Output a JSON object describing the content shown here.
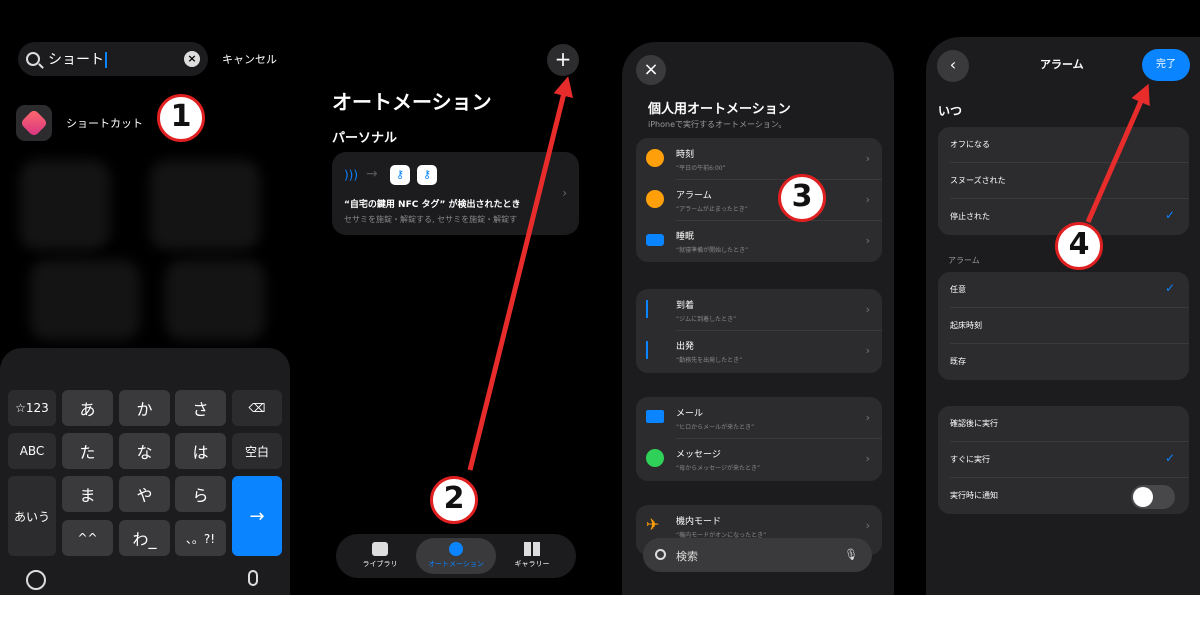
{
  "panel1": {
    "search_value": "ショート",
    "cancel_label": "キャンセル",
    "app_label": "ショートカット",
    "keyboard": {
      "row1": [
        "☆123",
        "あ",
        "か",
        "さ",
        "⌫"
      ],
      "row2": [
        "ABC",
        "た",
        "な",
        "は",
        "空白"
      ],
      "row3": [
        "あいう",
        "ま",
        "や",
        "ら"
      ],
      "row4": [
        "^^",
        "わ_",
        "、。?!"
      ],
      "enter": "→"
    }
  },
  "panel2": {
    "plus_label": "+",
    "title": "オートメーション",
    "section": "パーソナル",
    "card_title": "“自宅の鍵用 NFC タグ” が検出されたとき",
    "card_sub": "セサミを施錠・解錠する, セサミを施錠・解錠す",
    "tabs": [
      {
        "label": "ライブラリ",
        "active": false
      },
      {
        "label": "オートメーション",
        "active": true
      },
      {
        "label": "ギャラリー",
        "active": false
      }
    ]
  },
  "panel3": {
    "title": "個人用オートメーション",
    "subtitle": "iPhoneで実行するオートメーション。",
    "groups": [
      [
        {
          "title": "時刻",
          "sub": "“平日の午前6:00”",
          "icon": "clock-icon",
          "color": "#ff9f0a"
        },
        {
          "title": "アラーム",
          "sub": "“アラームが止まったとき”",
          "icon": "alarm-icon",
          "color": "#ff9f0a"
        },
        {
          "title": "睡眠",
          "sub": "“就寝準備が開始したとき”",
          "icon": "bed-icon",
          "color": "#0a84ff"
        }
      ],
      [
        {
          "title": "到着",
          "sub": "“ジムに到着したとき”",
          "icon": "arrive-icon",
          "color": "#0a84ff"
        },
        {
          "title": "出発",
          "sub": "“勤務先を出発したとき”",
          "icon": "leave-icon",
          "color": "#0a84ff"
        }
      ],
      [
        {
          "title": "メール",
          "sub": "“ヒロからメールが来たとき”",
          "icon": "mail-icon",
          "color": "#0a84ff"
        },
        {
          "title": "メッセージ",
          "sub": "“母からメッセージが来たとき”",
          "icon": "message-icon",
          "color": "#30d158"
        }
      ],
      [
        {
          "title": "機内モード",
          "sub": "“機内モードがオンになったとき”",
          "icon": "airplane-icon",
          "color": "#ff9f0a"
        }
      ]
    ],
    "search_placeholder": "検索"
  },
  "panel4": {
    "title": "アラーム",
    "done_label": "完了",
    "when_heading": "いつ",
    "when_options": [
      {
        "label": "オフになる",
        "checked": false
      },
      {
        "label": "スヌーズされた",
        "checked": false
      },
      {
        "label": "停止された",
        "checked": true
      }
    ],
    "alarm_caption": "アラーム",
    "alarm_options": [
      {
        "label": "任意",
        "checked": true
      },
      {
        "label": "起床時刻",
        "checked": false
      },
      {
        "label": "既存",
        "checked": false
      }
    ],
    "run_options": [
      {
        "label": "確認後に実行",
        "checked": false
      },
      {
        "label": "すぐに実行",
        "checked": true
      },
      {
        "label": "実行時に通知",
        "toggle": false
      }
    ]
  },
  "steps": [
    "1",
    "2",
    "3",
    "4"
  ],
  "colors": {
    "accent": "#0a84ff",
    "arrow": "#e82c2c",
    "badge_border": "#e02020"
  }
}
